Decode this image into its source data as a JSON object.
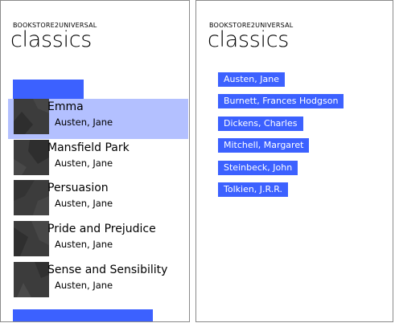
{
  "left_panel": {
    "app_name": "BOOKSTORE2UNIVERSAL",
    "page_title": "classics",
    "books": [
      {
        "title": "Emma",
        "author": "Austen, Jane",
        "selected": true
      },
      {
        "title": "Mansfield Park",
        "author": "Austen, Jane"
      },
      {
        "title": "Persuasion",
        "author": "Austen, Jane"
      },
      {
        "title": "Pride and Prejudice",
        "author": "Austen, Jane"
      },
      {
        "title": "Sense and Sensibility",
        "author": "Austen, Jane"
      }
    ]
  },
  "right_panel": {
    "app_name": "BOOKSTORE2UNIVERSAL",
    "page_title": "classics",
    "authors": [
      "Austen, Jane",
      "Burnett, Frances Hodgson",
      "Dickens, Charles",
      "Mitchell, Margaret",
      "Steinbeck, John",
      "Tolkien, J.R.R."
    ]
  },
  "colors": {
    "accent": "#3c61ff",
    "selection": "#b3c0ff",
    "thumbnail": "#3c3c3c"
  }
}
